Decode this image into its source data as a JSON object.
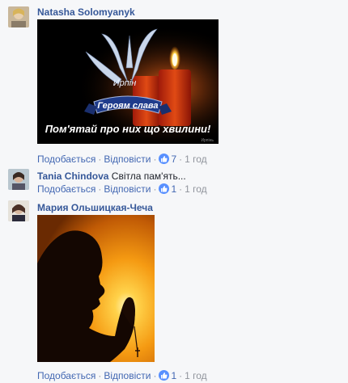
{
  "comments": [
    {
      "author": "Natasha Solomyanyk",
      "text": "",
      "image_alt": "Ирпинь героям слава",
      "image_text": {
        "ribbon_top": "Ирпін",
        "ribbon": "Героям слава",
        "caption": "Пом'ятай про них що хвилини!",
        "watermark": "Ирпінь"
      },
      "actions": {
        "like": "Подобається",
        "reply": "Відповісти",
        "reactions": "7",
        "time": "1 год"
      }
    },
    {
      "author": "Tania Chindova",
      "text": "Світла пам'ять...",
      "actions": {
        "like": "Подобається",
        "reply": "Відповісти",
        "reactions": "1",
        "time": "1 год"
      }
    },
    {
      "author": "Мария Ольшицкая-Чеча",
      "text": "",
      "actions": {
        "like": "Подобається",
        "reply": "Відповісти",
        "reactions": "1",
        "time": "1 год"
      }
    }
  ],
  "colors": {
    "author": "#365899",
    "link": "#4267b2",
    "meta": "#90949c",
    "like_badge": "#5890ff",
    "background": "#f6f7f9"
  }
}
